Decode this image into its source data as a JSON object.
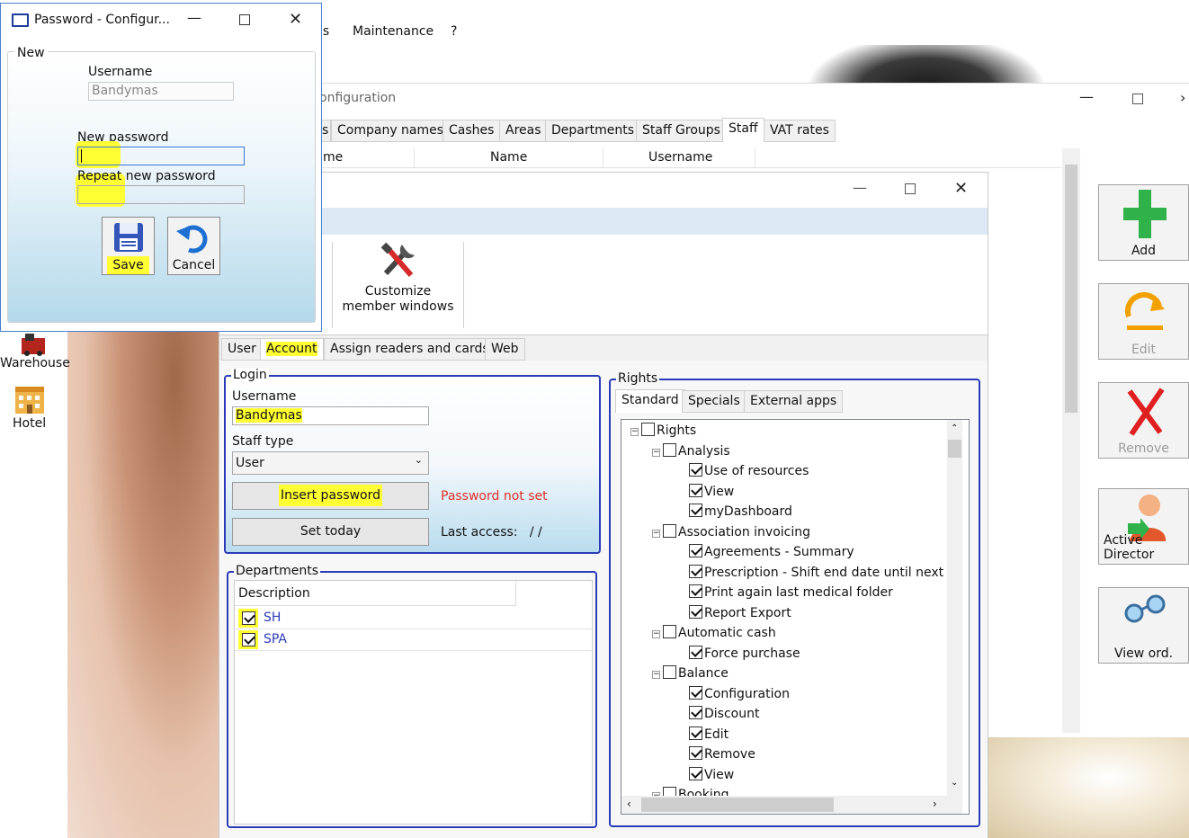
{
  "menubar": {
    "items": [
      "is",
      "Maintenance",
      "?"
    ]
  },
  "config_window": {
    "title": "onfiguration",
    "tabs": [
      "s",
      "Company names",
      "Cashes",
      "Areas",
      "Departments",
      "Staff Groups",
      "Staff",
      "VAT rates"
    ],
    "active_tab": "Staff",
    "grid_headers": [
      "me",
      "Name",
      "Username"
    ]
  },
  "side_buttons": [
    {
      "label": "Add",
      "icon": "plus-icon",
      "disabled": false
    },
    {
      "label": "Edit",
      "icon": "edit-arrow-icon",
      "disabled": true
    },
    {
      "label": "Remove",
      "icon": "red-x-icon",
      "disabled": true
    },
    {
      "label": "Active Director",
      "icon": "user-directory-icon",
      "disabled": false
    },
    {
      "label": "View ord.",
      "icon": "glasses-icon",
      "disabled": false
    }
  ],
  "desktop": {
    "warehouse": "Warehouse",
    "hotel": "Hotel"
  },
  "staff_window": {
    "ribbon_button": {
      "line1": "Customize",
      "line2": "member windows"
    },
    "subtabs": [
      "User",
      "Account",
      "Assign readers and cards",
      "Web"
    ],
    "active_subtab": "Account",
    "login": {
      "legend": "Login",
      "username_label": "Username",
      "username_value": "Bandymas",
      "staff_type_label": "Staff type",
      "staff_type_value": "User",
      "insert_password_button": "Insert password",
      "password_status": "Password not set",
      "set_today_button": "Set today",
      "last_access": "Last access:   / /"
    },
    "departments": {
      "legend": "Departments",
      "column": "Description",
      "rows": [
        {
          "name": "SH",
          "checked": true
        },
        {
          "name": "SPA",
          "checked": true
        }
      ]
    },
    "rights": {
      "legend": "Rights",
      "tabs": [
        "Standard",
        "Specials",
        "External apps"
      ],
      "tree": [
        {
          "label": "Rights",
          "level": 0,
          "checked": false,
          "expander": true
        },
        {
          "label": "Analysis",
          "level": 1,
          "checked": false,
          "expander": true
        },
        {
          "label": "Use of resources",
          "level": 2,
          "checked": true
        },
        {
          "label": "View",
          "level": 2,
          "checked": true
        },
        {
          "label": "myDashboard",
          "level": 2,
          "checked": true
        },
        {
          "label": "Association invoicing",
          "level": 1,
          "checked": false,
          "expander": true
        },
        {
          "label": "Agreements - Summary",
          "level": 2,
          "checked": true
        },
        {
          "label": "Prescription - Shift end date until next m",
          "level": 2,
          "checked": true
        },
        {
          "label": "Print again last medical folder",
          "level": 2,
          "checked": true
        },
        {
          "label": "Report Export",
          "level": 2,
          "checked": true
        },
        {
          "label": "Automatic cash",
          "level": 1,
          "checked": false,
          "expander": true
        },
        {
          "label": "Force purchase",
          "level": 2,
          "checked": true
        },
        {
          "label": "Balance",
          "level": 1,
          "checked": false,
          "expander": true
        },
        {
          "label": "Configuration",
          "level": 2,
          "checked": true
        },
        {
          "label": "Discount",
          "level": 2,
          "checked": true
        },
        {
          "label": "Edit",
          "level": 2,
          "checked": true
        },
        {
          "label": "Remove",
          "level": 2,
          "checked": true
        },
        {
          "label": "View",
          "level": 2,
          "checked": true
        },
        {
          "label": "Booking",
          "level": 1,
          "checked": false,
          "expander": true
        }
      ]
    }
  },
  "password_dialog": {
    "title": "Password - Configur...",
    "group_label": "New",
    "username_label": "Username",
    "username_value": "Bandymas",
    "new_password_label": "New password",
    "repeat_password_label": "Repeat new password",
    "save_button": "Save",
    "cancel_button": "Cancel"
  }
}
